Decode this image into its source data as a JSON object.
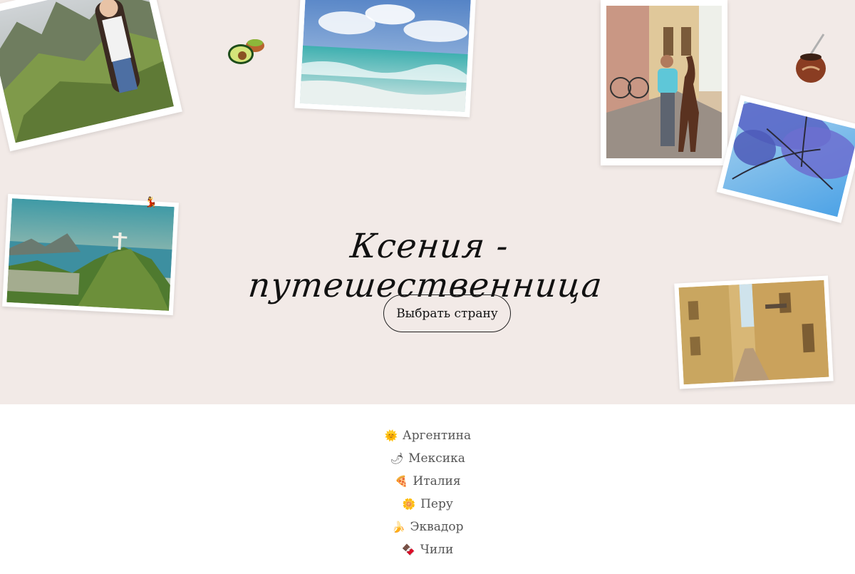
{
  "hero": {
    "title": "Ксения - путешественница",
    "cta_label": "Выбрать страну"
  },
  "photos": [
    {
      "name": "machu-picchu-photo",
      "subject": "Machu Picchu with traveler"
    },
    {
      "name": "ocean-waves-photo",
      "subject": "ocean waves and sky"
    },
    {
      "name": "llama-street-photo",
      "subject": "traveler with llama on street"
    },
    {
      "name": "jacaranda-photo",
      "subject": "purple jacaranda tree against sky"
    },
    {
      "name": "rio-christ-photo",
      "subject": "Rio de Janeiro with Christ statue"
    },
    {
      "name": "italian-street-photo",
      "subject": "narrow Italian street"
    }
  ],
  "decorations": [
    "avocado-guacamole-icon",
    "mate-gourd-icon",
    "dancer-icon"
  ],
  "countries": [
    {
      "emoji": "🌞",
      "name": "Аргентина"
    },
    {
      "emoji": "🌶",
      "name": "Мексика"
    },
    {
      "emoji": "🍕",
      "name": "Италия"
    },
    {
      "emoji": "🌼",
      "name": "Перу"
    },
    {
      "emoji": "🍌",
      "name": "Эквадор"
    },
    {
      "emoji": "🍫",
      "name": "Чили"
    }
  ],
  "colors": {
    "hero_background": "#f2eae7",
    "page_background": "#ffffff",
    "text_dark": "#111111",
    "text_muted": "#555555"
  }
}
